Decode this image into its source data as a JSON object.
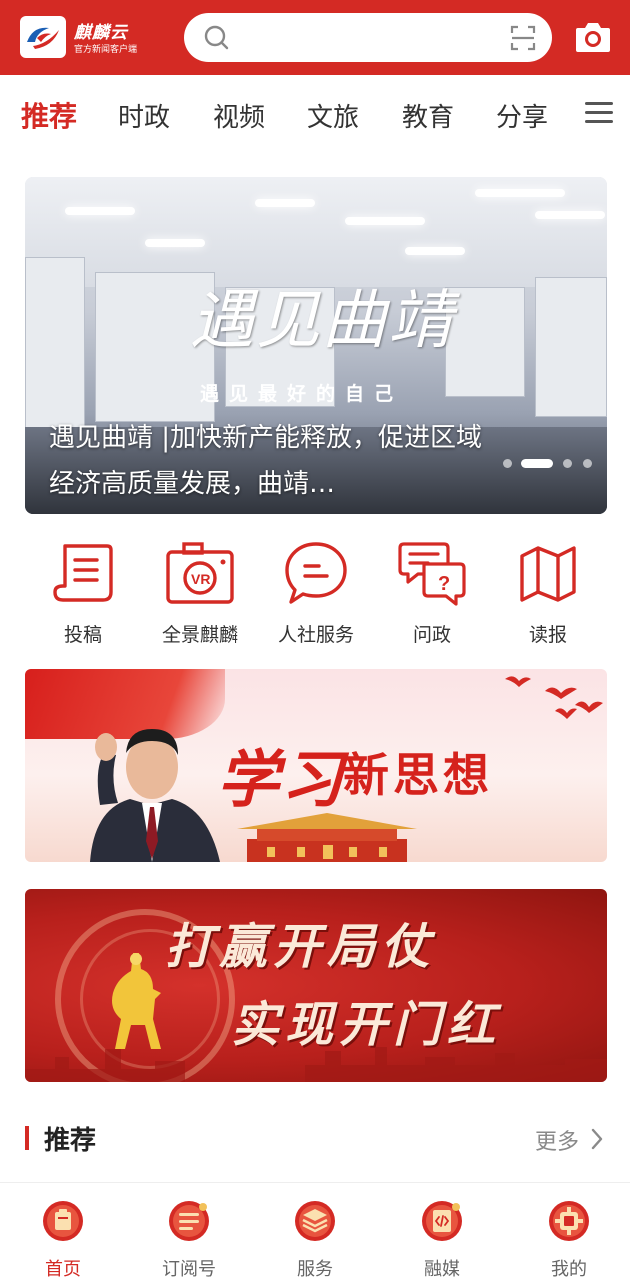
{
  "header": {
    "brand_name": "麒麟云",
    "brand_subtitle": "官方新闻客户端",
    "search_placeholder": "",
    "colors": {
      "brand_red": "#d42a24"
    }
  },
  "tabs": [
    {
      "label": "推荐",
      "active": true
    },
    {
      "label": "时政",
      "active": false
    },
    {
      "label": "视频",
      "active": false
    },
    {
      "label": "文旅",
      "active": false
    },
    {
      "label": "教育",
      "active": false
    },
    {
      "label": "分享",
      "active": false
    }
  ],
  "hero": {
    "calligraphy": "遇见曲靖",
    "tagline": "遇见最好的自己",
    "caption": "遇见曲靖 |加快新产能释放，促进区域经济高质量发展，曲靖…",
    "carousel_total": 4,
    "carousel_active": 2
  },
  "quick_entries": [
    {
      "label": "投稿",
      "icon": "document-icon"
    },
    {
      "label": "全景麒麟",
      "icon": "vr-camera-icon"
    },
    {
      "label": "人社服务",
      "icon": "chat-bubble-icon"
    },
    {
      "label": "问政",
      "icon": "question-chat-icon"
    },
    {
      "label": "读报",
      "icon": "map-icon"
    }
  ],
  "banner1": {
    "text_a": "学习",
    "text_b": "新思想"
  },
  "banner2": {
    "line1": "打赢开局仗",
    "line2": "实现开门红"
  },
  "section": {
    "title": "推荐",
    "more": "更多"
  },
  "bottom_nav": [
    {
      "label": "首页",
      "icon": "home-icon",
      "active": true
    },
    {
      "label": "订阅号",
      "icon": "subscribe-icon",
      "active": false
    },
    {
      "label": "服务",
      "icon": "service-icon",
      "active": false
    },
    {
      "label": "融媒",
      "icon": "media-icon",
      "active": false
    },
    {
      "label": "我的",
      "icon": "profile-icon",
      "active": false
    }
  ]
}
